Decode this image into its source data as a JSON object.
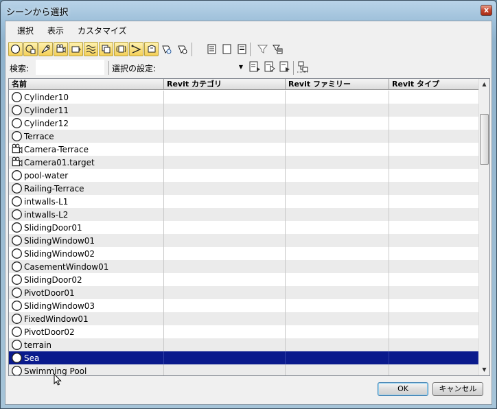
{
  "window": {
    "title": "シーンから選択",
    "close_label": "x"
  },
  "menu": [
    "選択",
    "表示",
    "カスタマイズ"
  ],
  "toolbar1": {
    "buttons": [
      {
        "icon": "geometry-icon",
        "active": true
      },
      {
        "icon": "shape-icon",
        "active": true
      },
      {
        "icon": "light-icon",
        "active": true
      },
      {
        "icon": "camera-icon",
        "active": true
      },
      {
        "icon": "helper-icon",
        "active": true
      },
      {
        "icon": "spacewarp-icon",
        "active": true
      },
      {
        "icon": "group-icon",
        "active": true
      },
      {
        "icon": "xref-icon",
        "active": true
      },
      {
        "icon": "bone-icon",
        "active": true
      },
      {
        "icon": "container-icon",
        "active": true
      },
      {
        "icon": "frozen-icon",
        "active": false
      },
      {
        "icon": "hidden-icon",
        "active": false
      },
      {
        "icon": "select-all-icon",
        "active": false
      },
      {
        "icon": "select-none-icon",
        "active": false
      },
      {
        "icon": "invert-selection-icon",
        "active": false
      },
      {
        "icon": "filter-icon",
        "active": false
      },
      {
        "icon": "filter-options-icon",
        "active": false
      }
    ]
  },
  "toolbar2": {
    "search_label": "検索:",
    "search_value": "",
    "selection_set_label": "選択の設定:",
    "selection_set_value": ""
  },
  "columns": [
    "名前",
    "Revit カテゴリ",
    "Revit ファミリー",
    "Revit タイプ"
  ],
  "rows": [
    {
      "name": "Cylinder10",
      "icon": "geometry-icon"
    },
    {
      "name": "Cylinder11",
      "icon": "geometry-icon"
    },
    {
      "name": "Cylinder12",
      "icon": "geometry-icon"
    },
    {
      "name": "Terrace",
      "icon": "geometry-icon"
    },
    {
      "name": "Camera-Terrace",
      "icon": "camera-icon"
    },
    {
      "name": "Camera01.target",
      "icon": "camera-icon"
    },
    {
      "name": "pool-water",
      "icon": "geometry-icon"
    },
    {
      "name": "Railing-Terrace",
      "icon": "geometry-icon"
    },
    {
      "name": "intwalls-L1",
      "icon": "geometry-icon"
    },
    {
      "name": "intwalls-L2",
      "icon": "geometry-icon"
    },
    {
      "name": "SlidingDoor01",
      "icon": "geometry-icon"
    },
    {
      "name": "SlidingWindow01",
      "icon": "geometry-icon"
    },
    {
      "name": "SlidingWindow02",
      "icon": "geometry-icon"
    },
    {
      "name": "CasementWindow01",
      "icon": "geometry-icon"
    },
    {
      "name": "SlidingDoor02",
      "icon": "geometry-icon"
    },
    {
      "name": "PivotDoor01",
      "icon": "geometry-icon"
    },
    {
      "name": "SlidingWindow03",
      "icon": "geometry-icon"
    },
    {
      "name": "FixedWindow01",
      "icon": "geometry-icon"
    },
    {
      "name": "PivotDoor02",
      "icon": "geometry-icon"
    },
    {
      "name": "terrain",
      "icon": "geometry-icon"
    },
    {
      "name": "Sea",
      "icon": "geometry-icon",
      "selected": true
    },
    {
      "name": "Swimming Pool",
      "icon": "geometry-icon"
    }
  ],
  "buttons": {
    "ok": "OK",
    "cancel": "キャンセル"
  }
}
